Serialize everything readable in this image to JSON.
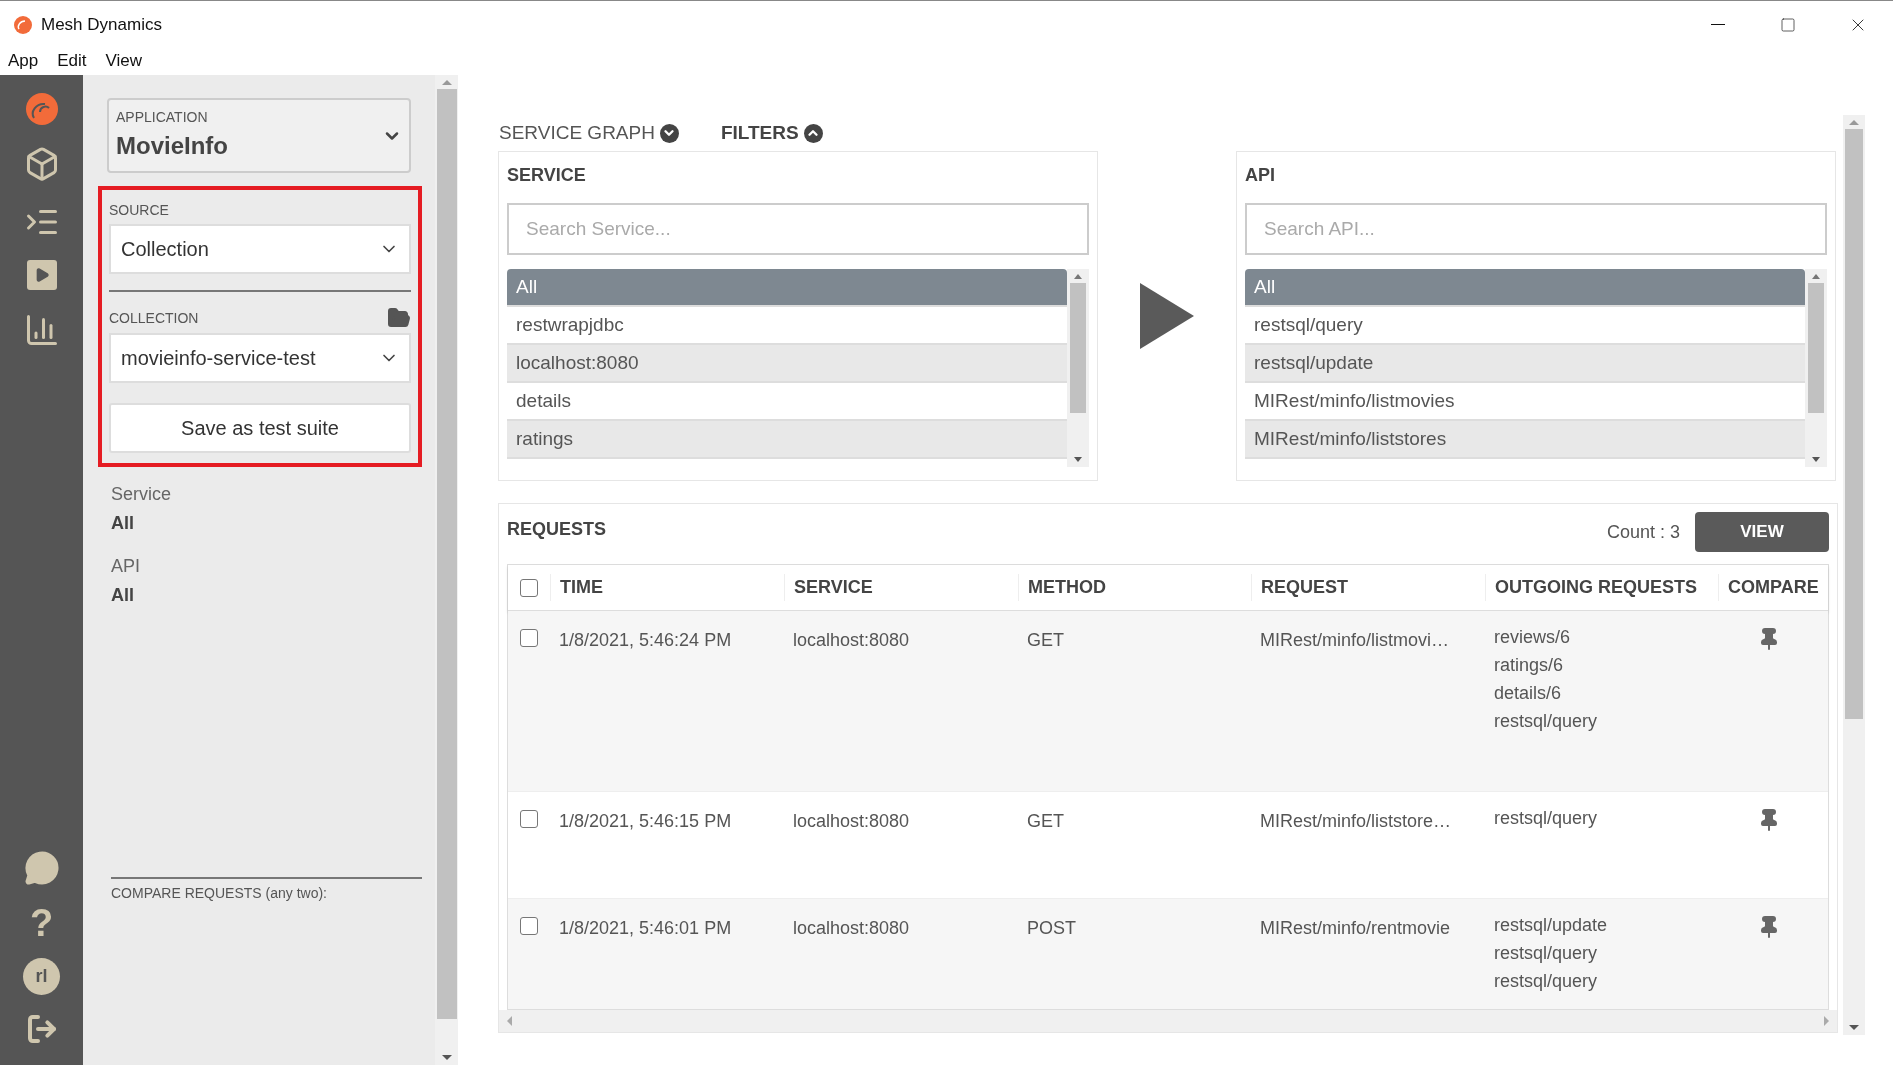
{
  "window": {
    "title": "Mesh Dynamics"
  },
  "menu": [
    "App",
    "Edit",
    "View"
  ],
  "rail": {
    "help": "?",
    "avatar": "rl"
  },
  "sidebar": {
    "application": {
      "label": "APPLICATION",
      "value": "MovieInfo"
    },
    "source": {
      "label": "SOURCE",
      "value": "Collection"
    },
    "collection": {
      "label": "COLLECTION",
      "value": "movieinfo-service-test"
    },
    "save_button": "Save as test suite",
    "filters": [
      {
        "label": "Service",
        "value": "All"
      },
      {
        "label": "API",
        "value": "All"
      }
    ],
    "compare_label": "COMPARE REQUESTS (any two):"
  },
  "toggles": [
    {
      "label": "SERVICE GRAPH",
      "expanded": false
    },
    {
      "label": "FILTERS",
      "expanded": true
    }
  ],
  "service": {
    "title": "SERVICE",
    "placeholder": "Search Service...",
    "items": [
      {
        "label": "All",
        "selected": true
      },
      {
        "label": "restwrapjdbc",
        "selected": false
      },
      {
        "label": "localhost:8080",
        "selected": false
      },
      {
        "label": "details",
        "selected": false
      },
      {
        "label": "ratings",
        "selected": false
      }
    ]
  },
  "api": {
    "title": "API",
    "placeholder": "Search API...",
    "items": [
      {
        "label": "All",
        "selected": true
      },
      {
        "label": "restsql/query",
        "selected": false
      },
      {
        "label": "restsql/update",
        "selected": false
      },
      {
        "label": "MIRest/minfo/listmovies",
        "selected": false
      },
      {
        "label": "MIRest/minfo/liststores",
        "selected": false
      }
    ]
  },
  "requests": {
    "title": "REQUESTS",
    "count": "Count : 3",
    "view_button": "VIEW",
    "all_checked": false,
    "columns": [
      "TIME",
      "SERVICE",
      "METHOD",
      "REQUEST",
      "OUTGOING REQUESTS",
      "COMPARE"
    ],
    "rows": [
      {
        "checked": false,
        "time": "1/8/2021, 5:46:24 PM",
        "service": "localhost:8080",
        "method": "GET",
        "request": "MIRest/minfo/listmovi…",
        "outgoing": [
          "reviews/6",
          "ratings/6",
          "details/6",
          "restsql/query"
        ]
      },
      {
        "checked": false,
        "time": "1/8/2021, 5:46:15 PM",
        "service": "localhost:8080",
        "method": "GET",
        "request": "MIRest/minfo/liststore…",
        "outgoing": [
          "restsql/query"
        ]
      },
      {
        "checked": false,
        "time": "1/8/2021, 5:46:01 PM",
        "service": "localhost:8080",
        "method": "POST",
        "request": "MIRest/minfo/rentmovie",
        "outgoing": [
          "restsql/update",
          "restsql/query",
          "restsql/query"
        ]
      }
    ]
  }
}
